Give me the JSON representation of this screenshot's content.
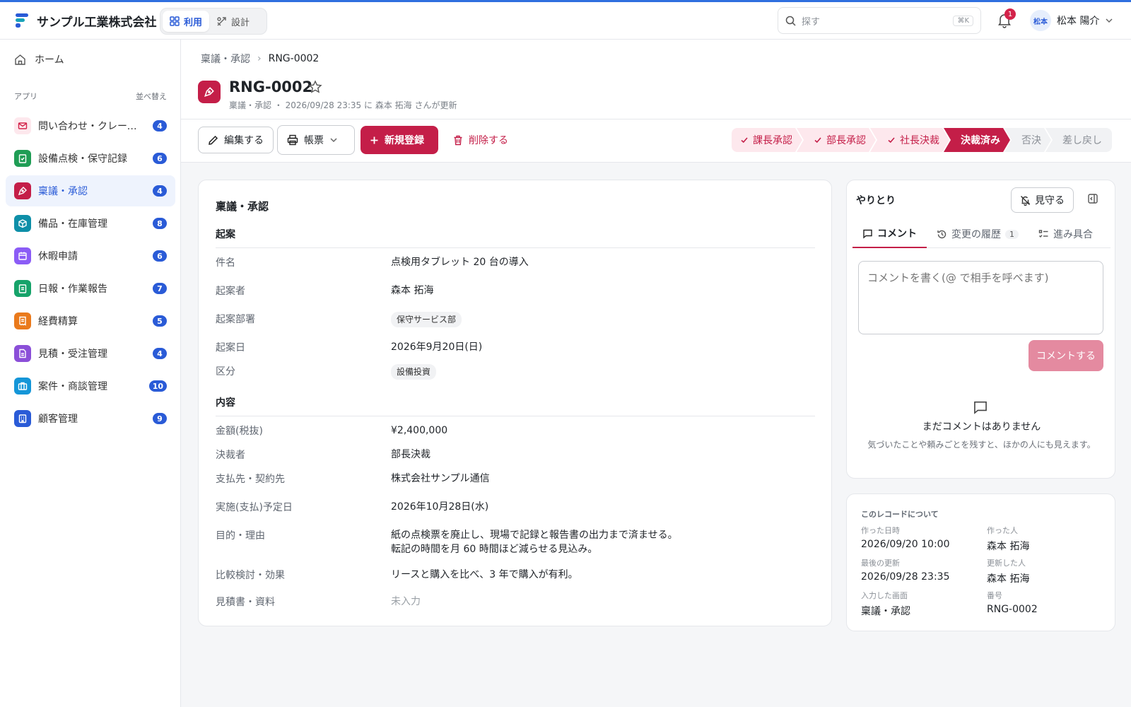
{
  "header": {
    "company": "サンプル工業株式会社",
    "modes": [
      {
        "label": "利用",
        "active": true
      },
      {
        "label": "設計",
        "active": false
      }
    ],
    "search_placeholder": "探す",
    "search_shortcut": "⌘K",
    "notification_count": "1",
    "user_avatar": "松本",
    "user_name": "松本 陽介"
  },
  "sidebar": {
    "home": "ホーム",
    "section_label": "アプリ",
    "sort_label": "並べ替え",
    "items": [
      {
        "label": "問い合わせ・クレーム管理",
        "count": "4",
        "color": "#d3234a"
      },
      {
        "label": "設備点検・保守記録",
        "count": "6",
        "color": "#1f9d55"
      },
      {
        "label": "稟議・承認",
        "count": "4",
        "color": "#c41e48",
        "active": true
      },
      {
        "label": "備品・在庫管理",
        "count": "8",
        "color": "#0e8fa8"
      },
      {
        "label": "休暇申請",
        "count": "6",
        "color": "#8b5cf6"
      },
      {
        "label": "日報・作業報告",
        "count": "7",
        "color": "#16a36a"
      },
      {
        "label": "経費精算",
        "count": "5",
        "color": "#ea7a1c"
      },
      {
        "label": "見積・受注管理",
        "count": "4",
        "color": "#8b4fd8"
      },
      {
        "label": "案件・商談管理",
        "count": "10",
        "color": "#1496d8"
      },
      {
        "label": "顧客管理",
        "count": "9",
        "color": "#2a5bd7"
      }
    ]
  },
  "page": {
    "breadcrumb_parent": "稟議・承認",
    "breadcrumb_current": "RNG-0002",
    "title": "RNG-0002",
    "subtitle": "稟議・承認 ・ 2026/09/28 23:35 に 森本 拓海 さんが更新"
  },
  "toolbar": {
    "edit": "編集する",
    "print": "帳票",
    "new": "新規登録",
    "delete": "削除する"
  },
  "steps": [
    {
      "label": "課長承認",
      "state": "done"
    },
    {
      "label": "部長承認",
      "state": "done"
    },
    {
      "label": "社長決裁",
      "state": "done"
    },
    {
      "label": "決裁済み",
      "state": "current"
    },
    {
      "label": "否決",
      "state": "pending"
    },
    {
      "label": "差し戻し",
      "state": "pending"
    }
  ],
  "record": {
    "card_title": "稟議・承認",
    "section1": "起案",
    "section2": "内容",
    "fields": {
      "subject": {
        "label": "件名",
        "value": "点検用タブレット 20 台の導入"
      },
      "drafter": {
        "label": "起案者",
        "value": "森本 拓海"
      },
      "department": {
        "label": "起案部署",
        "value": "保守サービス部"
      },
      "date": {
        "label": "起案日",
        "value": "2026年9月20日(日)"
      },
      "category": {
        "label": "区分",
        "value": "設備投資"
      },
      "amount": {
        "label": "金額(税抜)",
        "value": "¥2,400,000"
      },
      "approver": {
        "label": "決裁者",
        "value": "部長決裁"
      },
      "vendor": {
        "label": "支払先・契約先",
        "value": "株式会社サンプル通信"
      },
      "schedule": {
        "label": "実施(支払)予定日",
        "value": "2026年10月28日(水)"
      },
      "purpose": {
        "label": "目的・理由",
        "line1": "紙の点検票を廃止し、現場で記録と報告書の出力まで済ませる。",
        "line2": "転記の時間を月 60 時間ほど減らせる見込み。"
      },
      "comparison": {
        "label": "比較検討・効果",
        "value": "リースと購入を比べ、3 年で購入が有利。"
      },
      "attachments": {
        "label": "見積書・資料",
        "value": "未入力"
      }
    }
  },
  "panel": {
    "title": "やりとり",
    "watch": "見守る",
    "tabs": [
      {
        "label": "コメント",
        "active": true
      },
      {
        "label": "変更の履歴",
        "count": "1"
      },
      {
        "label": "進み具合"
      }
    ],
    "comment_placeholder": "コメントを書く(@ で相手を呼べます)",
    "comment_submit": "コメントする",
    "empty_title": "まだコメントはありません",
    "empty_desc": "気づいたことや頼みごとを残すと、ほかの人にも見えます。"
  },
  "meta": {
    "title": "このレコードについて",
    "created_at": {
      "label": "作った日時",
      "value": "2026/09/20 10:00"
    },
    "created_by": {
      "label": "作った人",
      "value": "森本 拓海"
    },
    "updated_at": {
      "label": "最後の更新",
      "value": "2026/09/28 23:35"
    },
    "updated_by": {
      "label": "更新した人",
      "value": "森本 拓海"
    },
    "screen": {
      "label": "入力した画面",
      "value": "稟議・承認"
    },
    "number": {
      "label": "番号",
      "value": "RNG-0002"
    }
  }
}
